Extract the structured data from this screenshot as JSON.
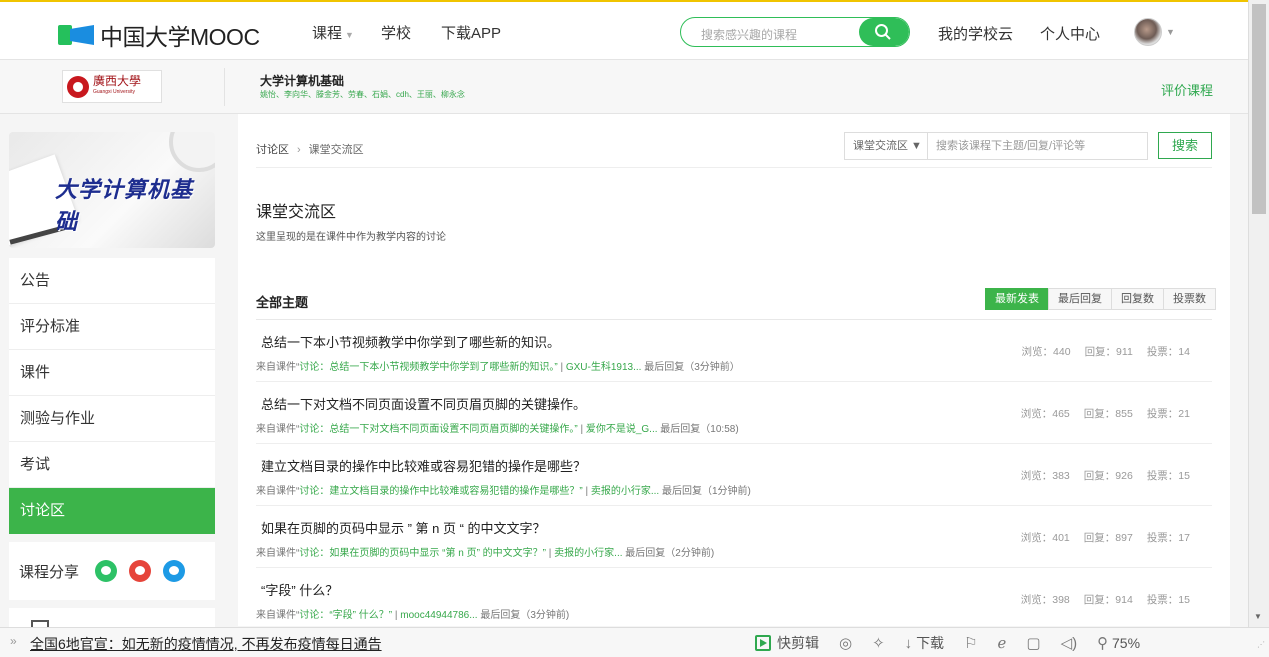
{
  "header": {
    "logo_text": "中国大学MOOC",
    "nav": [
      {
        "label": "课程",
        "has_caret": true
      },
      {
        "label": "学校",
        "has_caret": false
      },
      {
        "label": "下载APP",
        "has_caret": false
      }
    ],
    "search_placeholder": "搜索感兴趣的课程",
    "my_school_cloud": "我的学校云",
    "personal_center": "个人中心"
  },
  "course": {
    "school_name": "廣西大學",
    "school_name_en": "Guangxi University",
    "title": "大学计算机基础",
    "teachers": "姚怡、李向华、滕金芳、劳春、石娟、cdh、王丽、柳永念",
    "rate_label": "评价课程"
  },
  "sidebar": {
    "banner_text": "大学计算机基础",
    "items": [
      {
        "label": "公告",
        "active": false
      },
      {
        "label": "评分标准",
        "active": false
      },
      {
        "label": "课件",
        "active": false
      },
      {
        "label": "测验与作业",
        "active": false
      },
      {
        "label": "考试",
        "active": false
      },
      {
        "label": "讨论区",
        "active": true
      }
    ],
    "share_label": "课程分享"
  },
  "main": {
    "breadcrumb_root": "讨论区",
    "breadcrumb_sep": "›",
    "breadcrumb_current": "课堂交流区",
    "filter_select": "课堂交流区 ▼",
    "search_placeholder": "搜索该课程下主题/回复/评论等",
    "search_button": "搜索",
    "section_title": "课堂交流区",
    "section_desc": "这里呈现的是在课件中作为教学内容的讨论",
    "all_topics": "全部主题",
    "sort_tabs": [
      {
        "label": "最新发表",
        "active": true
      },
      {
        "label": "最后回复",
        "active": false
      },
      {
        "label": "回复数",
        "active": false
      },
      {
        "label": "投票数",
        "active": false
      }
    ],
    "threads": [
      {
        "title": "总结一下本小节视频教学中你学到了哪些新的知识。",
        "src_prefix": "来自课件“",
        "src_link": "讨论：总结一下本小节视频教学中你学到了哪些新的知识。”",
        "sep": " | ",
        "author": "GXU-生科1913...",
        "last": " 最后回复（3分钟前）",
        "views": "浏览：440",
        "replies": "回复：911",
        "votes": "投票：14"
      },
      {
        "title": "总结一下对文档不同页面设置不同页眉页脚的关键操作。",
        "src_prefix": "来自课件“",
        "src_link": "讨论：总结一下对文档不同页面设置不同页眉页脚的关键操作。”",
        "sep": " | ",
        "author": "爱你不是说_G...",
        "last": " 最后回复（10:58)",
        "views": "浏览：465",
        "replies": "回复：855",
        "votes": "投票：21"
      },
      {
        "title": "建立文档目录的操作中比较难或容易犯错的操作是哪些？",
        "src_prefix": "来自课件“",
        "src_link": "讨论：建立文档目录的操作中比较难或容易犯错的操作是哪些？”",
        "sep": " | ",
        "author": "卖报的小行家...",
        "last": " 最后回复（1分钟前)",
        "views": "浏览：383",
        "replies": "回复：926",
        "votes": "投票：15"
      },
      {
        "title": "如果在页脚的页码中显示 ” 第 n 页 “ 的中文文字？",
        "src_prefix": "来自课件“",
        "src_link": "讨论：如果在页脚的页码中显示 “第 n 页” 的中文文字？”",
        "sep": " | ",
        "author": "卖报的小行家...",
        "last": " 最后回复（2分钟前)",
        "views": "浏览：401",
        "replies": "回复：897",
        "votes": "投票：17"
      },
      {
        "title": "“字段” 什么？",
        "src_prefix": "来自课件“",
        "src_link": "讨论：“字段” 什么？”",
        "sep": " | ",
        "author": "mooc44944786...",
        "last": " 最后回复（3分钟前)",
        "views": "浏览：398",
        "replies": "回复：914",
        "votes": "投票：15"
      }
    ]
  },
  "statusbar": {
    "news": "全国6地官宣：如无新的疫情情况, 不再发布疫情每日通告",
    "quick_edit": "快剪辑",
    "download": "下载",
    "zoom": "75%"
  },
  "colors": {
    "brand_green": "#3cb44a",
    "link_green": "#37a84b",
    "school_red": "#a3161b"
  }
}
